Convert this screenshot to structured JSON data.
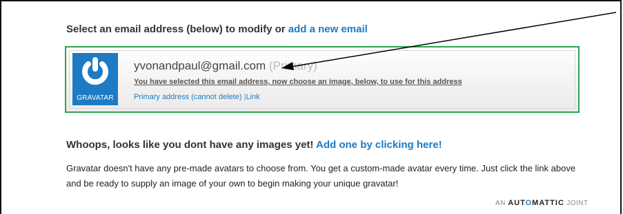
{
  "heading": {
    "text": "Select an email address (below) to modify or ",
    "link": "add a new email"
  },
  "email_box": {
    "logo_label": "GRAVATAR",
    "email": "yvonandpaul@gmail.com",
    "primary_tag": "(Primary)",
    "selected_note": "You have selected this email address, now choose an image, below, to use for this address",
    "primary_address_link": "Primary address (cannot delete)",
    "separator": "|",
    "link_label": "Link"
  },
  "whoops": {
    "text": "Whoops, looks like you dont have any images yet! ",
    "link": "Add one by clicking here!"
  },
  "description": "Gravatar doesn't have any pre-made avatars to choose from. You get a custom-made avatar every time. Just click the link above and be ready to supply an image of your own to begin making your unique gravatar!",
  "footer": {
    "prefix": "AN",
    "brand_a": "AUT",
    "brand_o": "O",
    "brand_b": "MATTIC",
    "suffix": "JOINT"
  },
  "colors": {
    "link": "#1e7ac3",
    "selected_border": "#2aa34b",
    "logo_bg": "#1e7ac3"
  },
  "icons": [
    "gravatar-logo-icon",
    "annotation-arrow-icon"
  ]
}
